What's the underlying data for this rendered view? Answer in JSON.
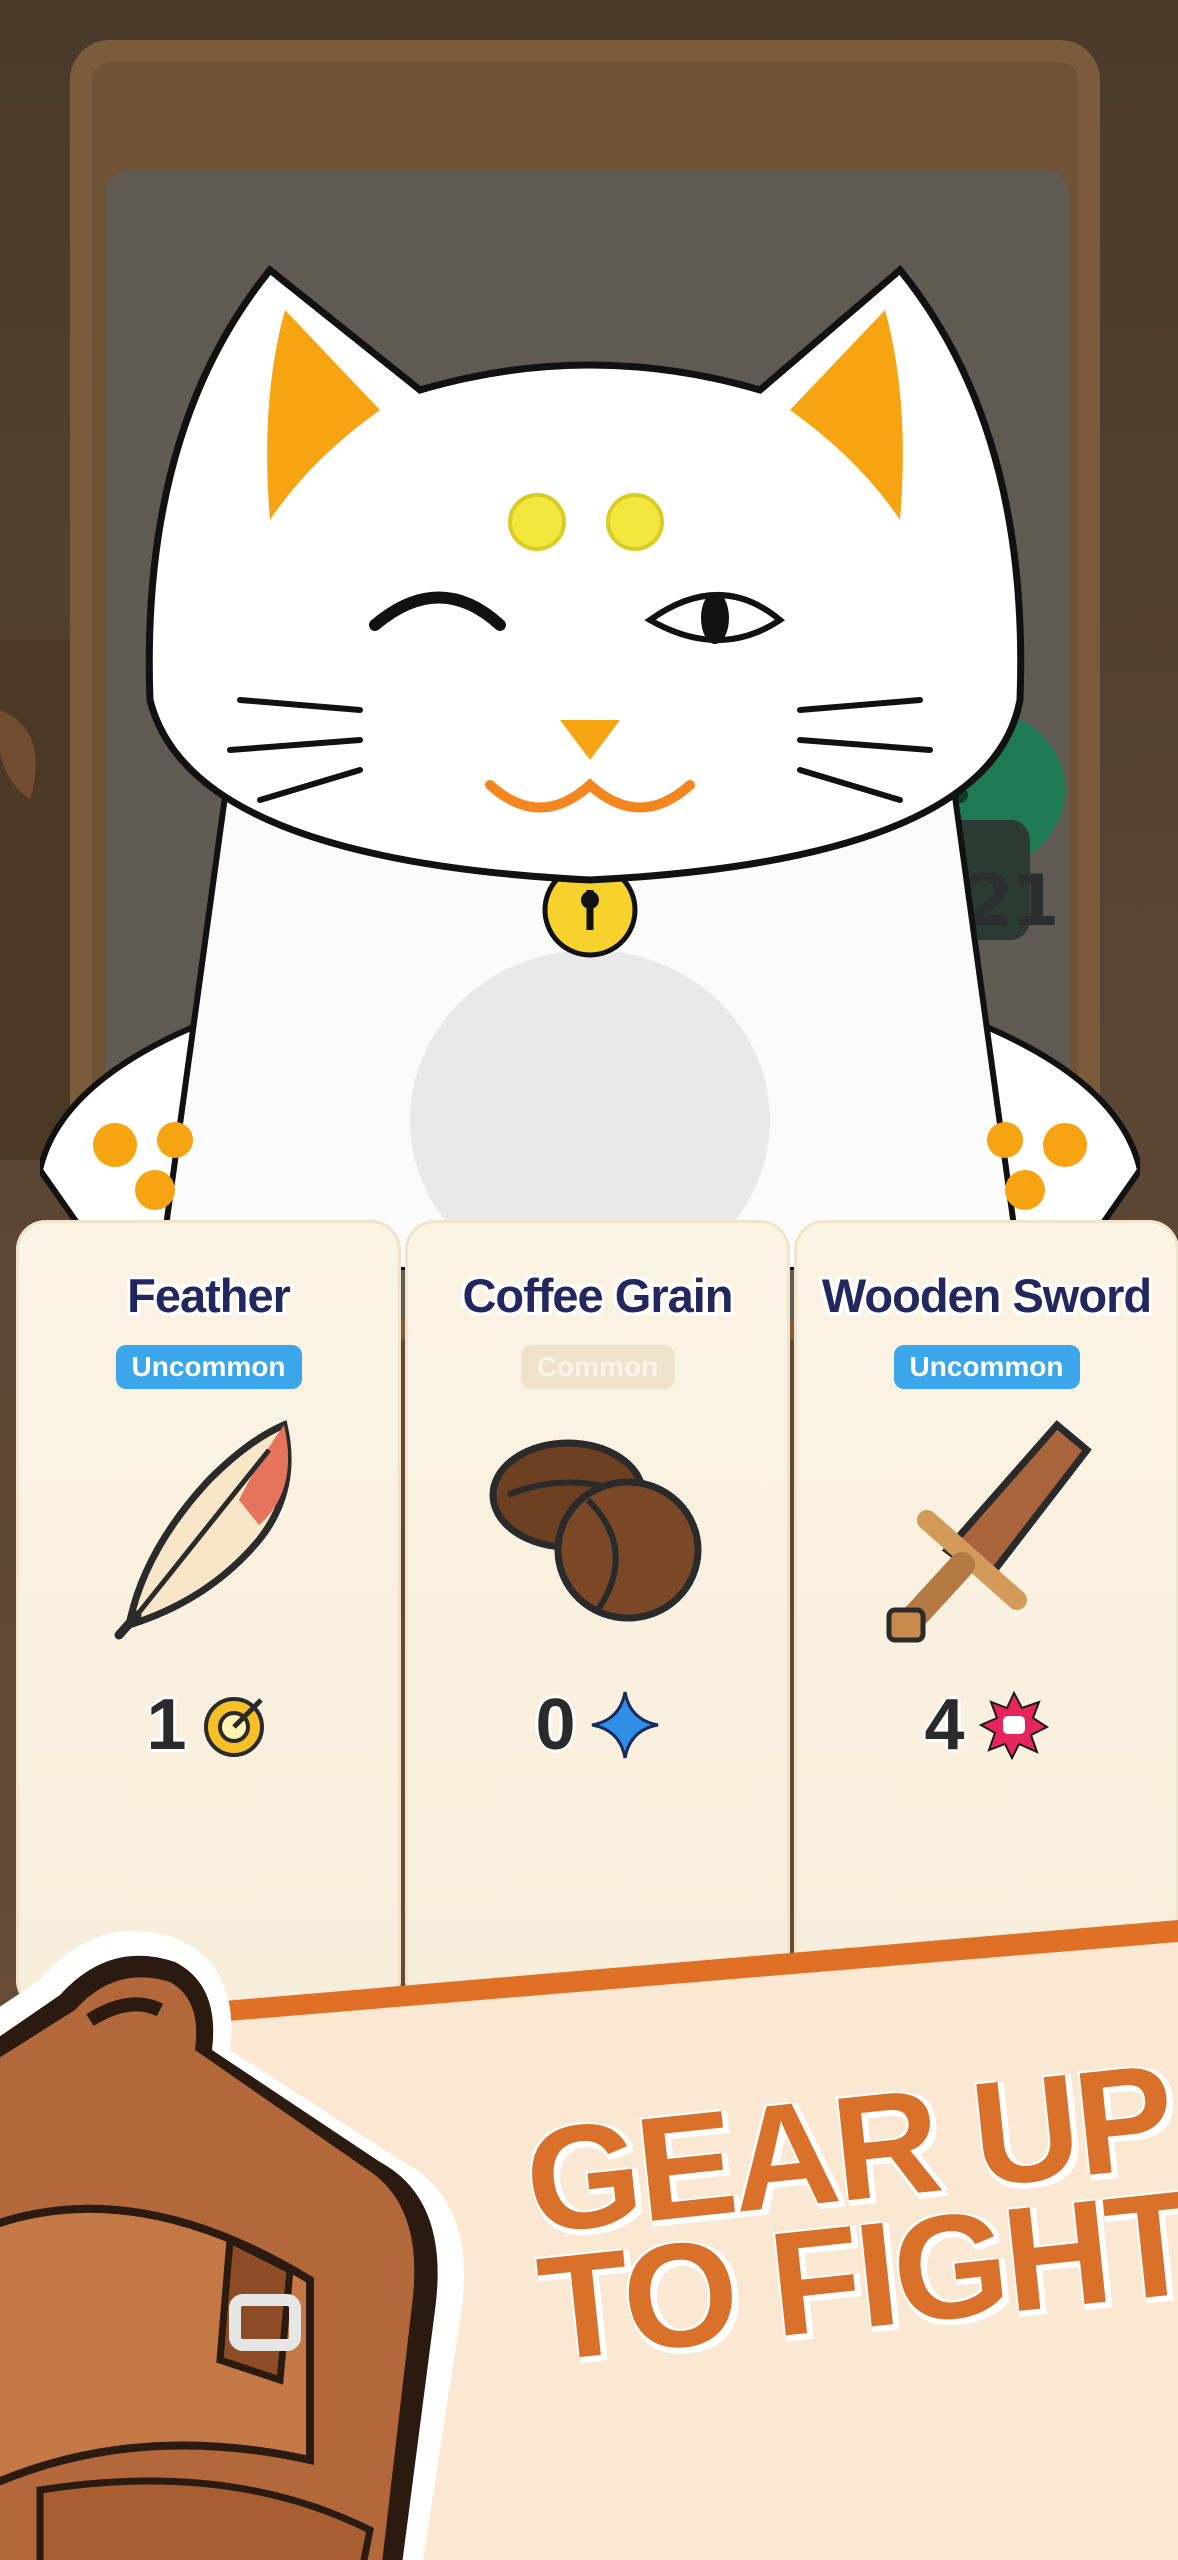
{
  "cards": [
    {
      "title": "Feather",
      "rarity": "Uncommon",
      "stat_value": "1",
      "stat_icon": "target-icon"
    },
    {
      "title": "Coffee Grain",
      "rarity": "Common",
      "stat_value": "0",
      "stat_icon": "sparkle-icon"
    },
    {
      "title": "Wooden Sword",
      "rarity": "Uncommon",
      "stat_value": "4",
      "stat_icon": "fist-icon"
    }
  ],
  "enemy": {
    "number": "21"
  },
  "banner": {
    "line1": "GEAR UP",
    "line2": "TO FIGHT"
  },
  "colors": {
    "uncommon": "#3ba7ea",
    "banner_text": "#d9712b",
    "card_bg": "#fbf3e4"
  }
}
